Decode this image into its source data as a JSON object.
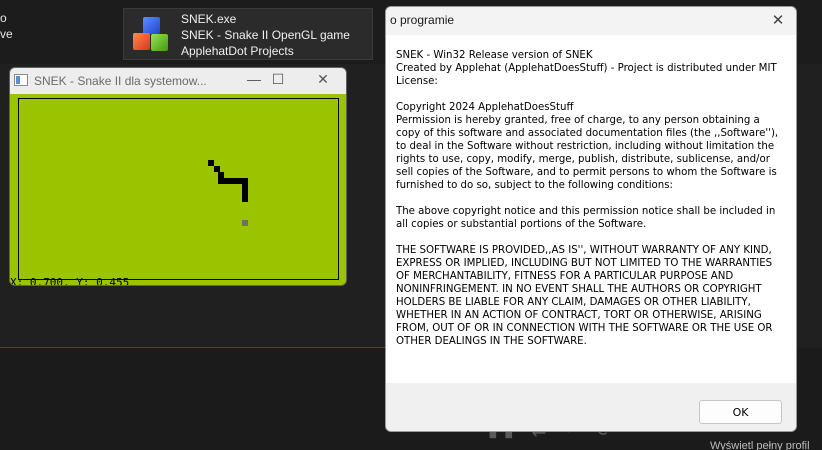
{
  "background": {
    "left_text_1": "o",
    "left_text_2": "ve",
    "bottom_glyphs": "▮▮ ⇄ ↶ ⟳",
    "profile_link": "Wyświetl pełny profil"
  },
  "taskbar_tooltip": {
    "exe_name": "SNEK.exe",
    "description": "SNEK - Snake II OpenGL game",
    "company": "ApplehatDot Projects",
    "icon": "colored-cubes-icon"
  },
  "snake_window": {
    "title": "SNEK - Snake II dla systemow...",
    "controls": {
      "minimize": "—",
      "maximize": "☐",
      "close": "✕"
    },
    "coordinates": "X: 0.700, Y: 0.455",
    "colors": {
      "screen": "#9ac300",
      "snake": "#000000",
      "food": "#6f7068"
    }
  },
  "about_dialog": {
    "title": "o programie",
    "close": "✕",
    "line1": "SNEK - Win32 Release version of SNEK",
    "line2": "Created by Applehat (ApplehatDoesStuff) - Project is distributed under MIT License:",
    "copyright": "Copyright 2024 ApplehatDoesStuff",
    "permission": "Permission is hereby granted, free of charge, to any person obtaining a copy of this software and associated documentation files (the ,,Software''), to deal in the Software without restriction, including without limitation the rights to use, copy, modify, merge, publish, distribute, sublicense, and/or sell copies of the Software, and to permit persons to whom the Software is furnished to do so, subject to the following conditions:",
    "notice": "The above copyright notice and this permission notice shall be included in all copies or substantial portions of the Software.",
    "disclaimer": "THE SOFTWARE IS PROVIDED,,AS IS'', WITHOUT WARRANTY OF ANY KIND, EXPRESS OR IMPLIED, INCLUDING BUT NOT LIMITED TO THE WARRANTIES OF MERCHANTABILITY, FITNESS FOR A PARTICULAR PURPOSE AND NONINFRINGEMENT. IN NO EVENT SHALL THE AUTHORS OR COPYRIGHT HOLDERS BE LIABLE FOR ANY CLAIM, DAMAGES OR OTHER LIABILITY, WHETHER IN AN ACTION OF CONTRACT, TORT OR OTHERWISE, ARISING FROM, OUT OF OR IN CONNECTION WITH THE SOFTWARE OR THE USE OR OTHER DEALINGS IN THE SOFTWARE.",
    "ok_label": "OK"
  }
}
